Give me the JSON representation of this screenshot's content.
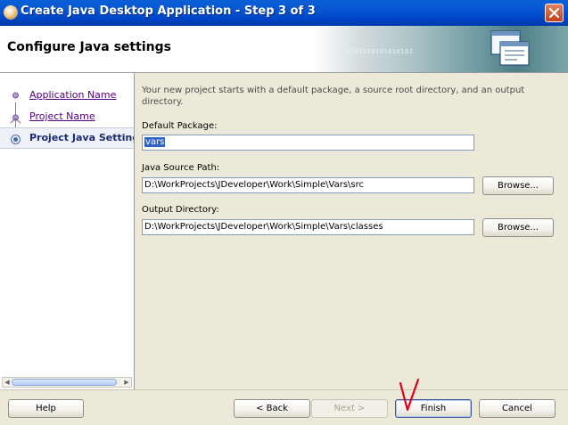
{
  "window": {
    "title": "Create Java Desktop Application - Step 3 of 3",
    "close_icon": "close-icon"
  },
  "header": {
    "heading": "Configure Java settings",
    "banner_text": "0101010101010101"
  },
  "wizard_steps": [
    {
      "label": "Application Name",
      "state": "completed"
    },
    {
      "label": "Project Name",
      "state": "completed"
    },
    {
      "label": "Project Java Settings",
      "state": "current"
    }
  ],
  "form": {
    "intro": "Your new project starts with a default package, a source root directory, and an output directory.",
    "default_package_label": "Default Package:",
    "default_package_value": "vars",
    "java_source_path_label": "Java Source Path:",
    "java_source_path_value": "D:\\WorkProjects\\JDeveloper\\Work\\Simple\\Vars\\src",
    "output_directory_label": "Output Directory:",
    "output_directory_value": "D:\\WorkProjects\\JDeveloper\\Work\\Simple\\Vars\\classes",
    "browse_label": "Browse..."
  },
  "footer": {
    "help_label": "Help",
    "back_label": "< Back",
    "next_label": "Next >",
    "finish_label": "Finish",
    "cancel_label": "Cancel"
  },
  "colors": {
    "titlebar": "#0046c9",
    "annotation_mark": "#e0001a",
    "selection": "#3163c5"
  }
}
